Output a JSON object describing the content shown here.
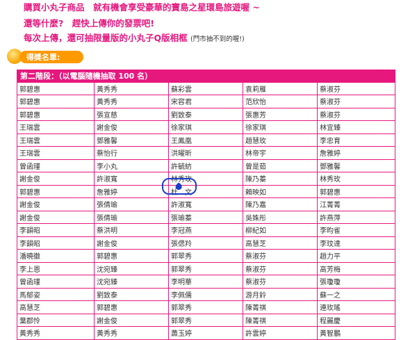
{
  "promo": {
    "line1": "購買小丸子商品　就有機會享受豪華的寶島之星環島旅遊喔 ~",
    "line2": "還等什麼?　趕快上傳你的發票吧!",
    "line3": "每次上傳，還可抽限量版的小丸子Q版相框",
    "line3_note": "(門市抽不到的喔!)"
  },
  "winners_badge": {
    "label": "得獎名單:",
    "icon": "orange-ball-icon"
  },
  "table": {
    "header": "第二階段：（以電腦隨機抽取 100 名）",
    "rows": [
      [
        "郭碧惠",
        "黃秀秀",
        "蘇彩雲",
        "袁莉雁",
        "蔡淑芬"
      ],
      [
        "郭碧惠",
        "黃秀秀",
        "宋容君",
        "范欣怡",
        "蔡淑芬"
      ],
      [
        "郭碧惠",
        "張宣慈",
        "劉致泰",
        "張惠芳",
        "蔡淑芬"
      ],
      [
        "王瑞雲",
        "謝金俊",
        "徐家琪",
        "徐家琪",
        "林宜臻"
      ],
      [
        "王瑞雲",
        "鄧雅馨",
        "王鳳凰",
        "趙慧玫",
        "李忠育"
      ],
      [
        "王瑞雲",
        "蔡怡行",
        "洪曜昕",
        "林帝宇",
        "詹雅婷"
      ],
      [
        "曾函瑾",
        "李小丸",
        "許毓紡",
        "曾是茹",
        "鄧雅馨"
      ],
      [
        "謝金俊",
        "許淑寬",
        "林秀玫",
        "陳乃蓁",
        "林秀玫"
      ],
      [
        "郭碧惠",
        "詹雅婷",
        "杜　文",
        "賴映如",
        "郭碧惠"
      ],
      [
        "謝金俊",
        "張倩瑜",
        "許淑寬",
        "陳乃嘉",
        "江菁菁"
      ],
      [
        "謝金俊",
        "張倩瑜",
        "張瑜蓁",
        "吳姝彤",
        "許燕萍"
      ],
      [
        "李韻昭",
        "蔡洪明",
        "李冠燕",
        "柳紀如",
        "李昀雀"
      ],
      [
        "李韻昭",
        "謝金俊",
        "張偲羚",
        "高慧芝",
        "李玟達"
      ],
      [
        "潘曉徽",
        "郭碧惠",
        "郭翠秀",
        "蔡淑芬",
        "趙力平"
      ],
      [
        "李上恩",
        "沈宛臻",
        "郭翠秀",
        "蔡淑芬",
        "高芳梅"
      ],
      [
        "曾函瑾",
        "沈宛臻",
        "李明華",
        "蔡淑芬",
        "張瓊瓊"
      ],
      [
        "馬郁姿",
        "劉致泰",
        "李佩儒",
        "游月鈴",
        "蘇一之"
      ],
      [
        "高慧芝",
        "郭碧惠",
        "郭翠秀",
        "陳菁祺",
        "連玫瑤"
      ],
      [
        "葉郡怜",
        "謝金俊",
        "郭翠秀",
        "陳菁祺",
        "程麗慶"
      ],
      [
        "黃秀秀",
        "黃秀秀",
        "蕭玉婷",
        "許雲婷",
        "黃智鵬"
      ]
    ]
  }
}
